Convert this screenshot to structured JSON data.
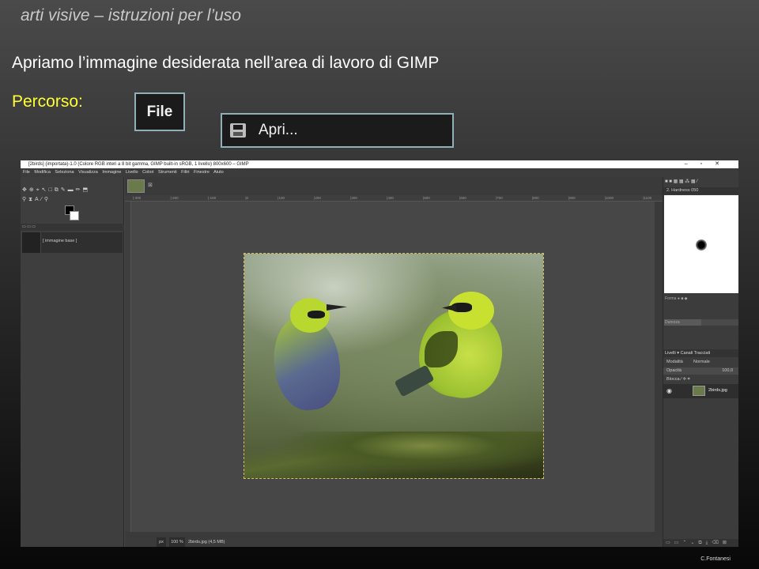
{
  "slide": {
    "header": "arti visive – istruzioni per l’uso",
    "instruction": "Apriamo l’immagine desiderata nell’area di lavoro di GIMP",
    "path_label": "Percorso:",
    "file_menu_label": "File",
    "open_menu_label": "Apri...",
    "author": "C.Fontanesi"
  },
  "gimp": {
    "window_title": "[2birds] (importata)-1.0 (Colore RGB interi a 8 bit gamma, GIMP built-in sRGB, 1 livello) 800x600 – GIMP",
    "window_buttons": [
      "–",
      "▫",
      "✕"
    ],
    "menu": [
      "File",
      "Modifica",
      "Seleziona",
      "Visualizza",
      "Immagine",
      "Livello",
      "Colori",
      "Strumenti",
      "Filtri",
      "Finestre",
      "Aiuto"
    ],
    "image_list_item": "[ immagine base ]",
    "ruler_ticks": [
      "|-300",
      "|-200",
      "|-100",
      "|0",
      "|100",
      "|200",
      "|300",
      "|400",
      "|500",
      "|600",
      "|700",
      "|800",
      "|900",
      "|1000",
      "|1100"
    ],
    "status": {
      "unit": "px",
      "zoom": "100 %",
      "file": "2birds.jpg (4,5 MB)"
    },
    "brushes": {
      "brush_name": "2. Hardness 050",
      "options": [
        "Forma",
        "Durezza"
      ],
      "durezza_fraction": 0.5
    },
    "layers": {
      "tabs": [
        "Livelli",
        "Canali",
        "Tracciati"
      ],
      "mode_label": "Modalità",
      "mode_value": "Normale",
      "opacity_label": "Opacità",
      "opacity_value": "100,0",
      "lock_label": "Blocca",
      "layer_name": "2birds.jpg"
    }
  },
  "colors": {
    "accent_yellow": "#ffff33",
    "crop_border": "#8fb0b6"
  }
}
